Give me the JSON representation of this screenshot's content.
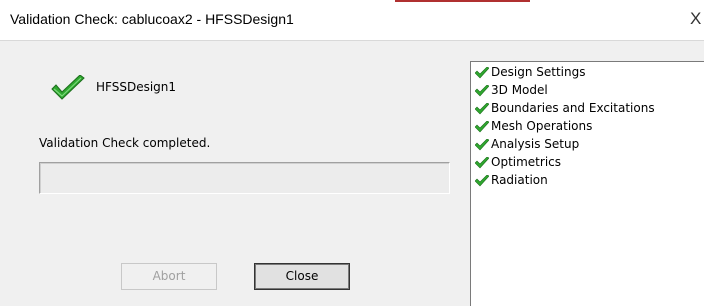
{
  "window": {
    "title": "Validation Check: cablucoax2 - HFSSDesign1",
    "close_glyph": "X"
  },
  "summary": {
    "design_name": "HFSSDesign1",
    "status_icon": "green-check-icon",
    "status_text": "Validation Check completed.",
    "progress_percent": 0
  },
  "buttons": {
    "abort_label": "Abort",
    "close_label": "Close"
  },
  "results": {
    "items": [
      {
        "label": "Design Settings",
        "icon": "green-check-icon"
      },
      {
        "label": "3D Model",
        "icon": "green-check-icon"
      },
      {
        "label": "Boundaries and Excitations",
        "icon": "green-check-icon"
      },
      {
        "label": "Mesh Operations",
        "icon": "green-check-icon"
      },
      {
        "label": "Analysis Setup",
        "icon": "green-check-icon"
      },
      {
        "label": "Optimetrics",
        "icon": "green-check-icon"
      },
      {
        "label": "Radiation",
        "icon": "green-check-icon"
      }
    ]
  },
  "colors": {
    "check_green": "#2fa82f",
    "dialog_bg": "#f0f0f0"
  }
}
